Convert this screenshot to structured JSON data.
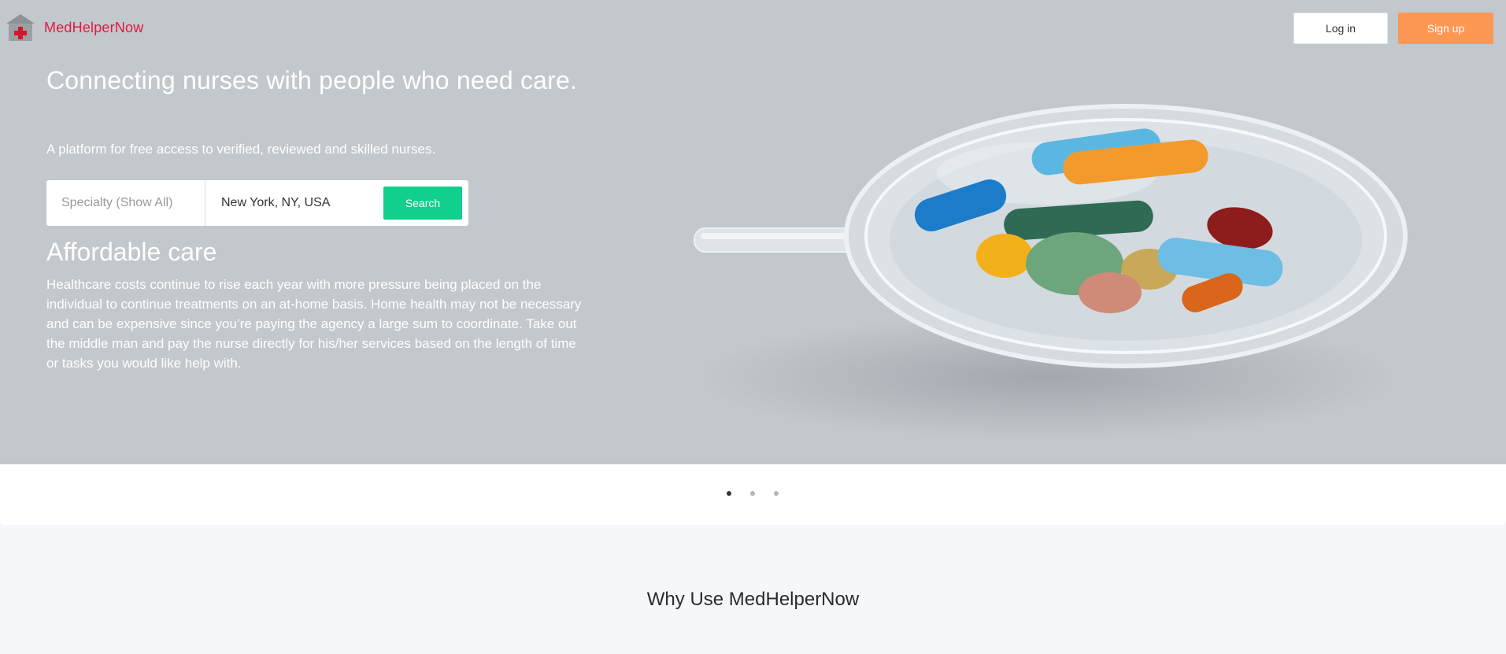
{
  "brand": {
    "name": "MedHelperNow",
    "icon": "hospital-icon",
    "color": "#e0193f"
  },
  "header": {
    "login_label": "Log in",
    "signup_label": "Sign up"
  },
  "hero": {
    "headline": "Connecting nurses with people who need care.",
    "subheadline": "A platform for free access to verified, reviewed and skilled nurses.",
    "image": "pills-in-glass-dish"
  },
  "search": {
    "specialty_placeholder": "Specialty (Show All)",
    "location_value": "New York, NY, USA",
    "button_label": "Search"
  },
  "slide": {
    "title": "Affordable care",
    "body": "Healthcare costs continue to rise each year with more pressure being placed on the individual to continue treatments on an at-home basis.  Home health may not be necessary and can be expensive since you’re paying the agency a large sum to coordinate.  Take out the middle man and pay the nurse directly for his/her services based on the length of time or tasks you would like help with."
  },
  "carousel": {
    "total": 3,
    "active": 1
  },
  "why": {
    "title": "Why Use MedHelperNow"
  },
  "colors": {
    "accent_green": "#10d08b",
    "accent_orange": "#fd9754",
    "hero_bg": "#c3c8cc"
  }
}
